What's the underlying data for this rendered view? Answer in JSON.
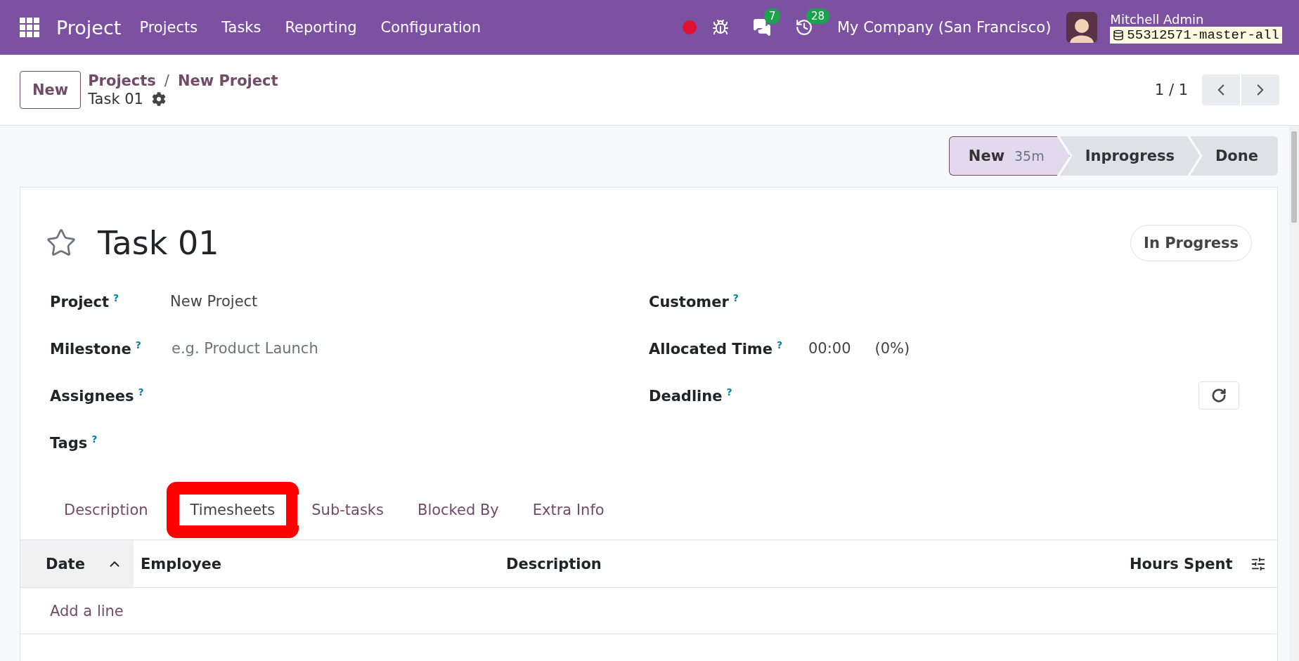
{
  "navbar": {
    "app_name": "Project",
    "menu": [
      "Projects",
      "Tasks",
      "Reporting",
      "Configuration"
    ],
    "messages_count": "7",
    "activities_count": "28",
    "company": "My Company (San Francisco)",
    "user": "Mitchell Admin",
    "database": "55312571-master-all"
  },
  "control_panel": {
    "new_button": "New",
    "breadcrumbs": [
      "Projects",
      "New Project"
    ],
    "breadcrumb_separator": "/",
    "current": "Task 01",
    "pager": "1 / 1"
  },
  "stages": [
    {
      "label": "New",
      "duration": "35m",
      "selected": true
    },
    {
      "label": "Inprogress",
      "selected": false
    },
    {
      "label": "Done",
      "selected": false
    }
  ],
  "task": {
    "starred": false,
    "title": "Task 01",
    "state": "In Progress"
  },
  "left_fields": [
    {
      "label": "Project",
      "value": "New Project"
    },
    {
      "label": "Milestone",
      "placeholder": "e.g. Product Launch"
    },
    {
      "label": "Assignees"
    },
    {
      "label": "Tags"
    }
  ],
  "right_fields": [
    {
      "label": "Customer"
    },
    {
      "label": "Allocated Time",
      "value": "00:00",
      "extra": "(0%)"
    },
    {
      "label": "Deadline",
      "kind": "refresh"
    }
  ],
  "help_mark": "?",
  "tabs": [
    {
      "label": "Description",
      "selected": false,
      "highlighted": false
    },
    {
      "label": "Timesheets",
      "selected": true,
      "highlighted": true
    },
    {
      "label": "Sub-tasks",
      "selected": false,
      "highlighted": false
    },
    {
      "label": "Blocked By",
      "selected": false,
      "highlighted": false
    },
    {
      "label": "Extra Info",
      "selected": false,
      "highlighted": false
    }
  ],
  "table": {
    "columns": [
      {
        "label": "Date",
        "sorted": true
      },
      {
        "label": "Employee",
        "sorted": false
      },
      {
        "label": "Description",
        "sorted": false
      },
      {
        "label": "Hours Spent",
        "sorted": false
      }
    ],
    "add_line": "Add a line"
  }
}
